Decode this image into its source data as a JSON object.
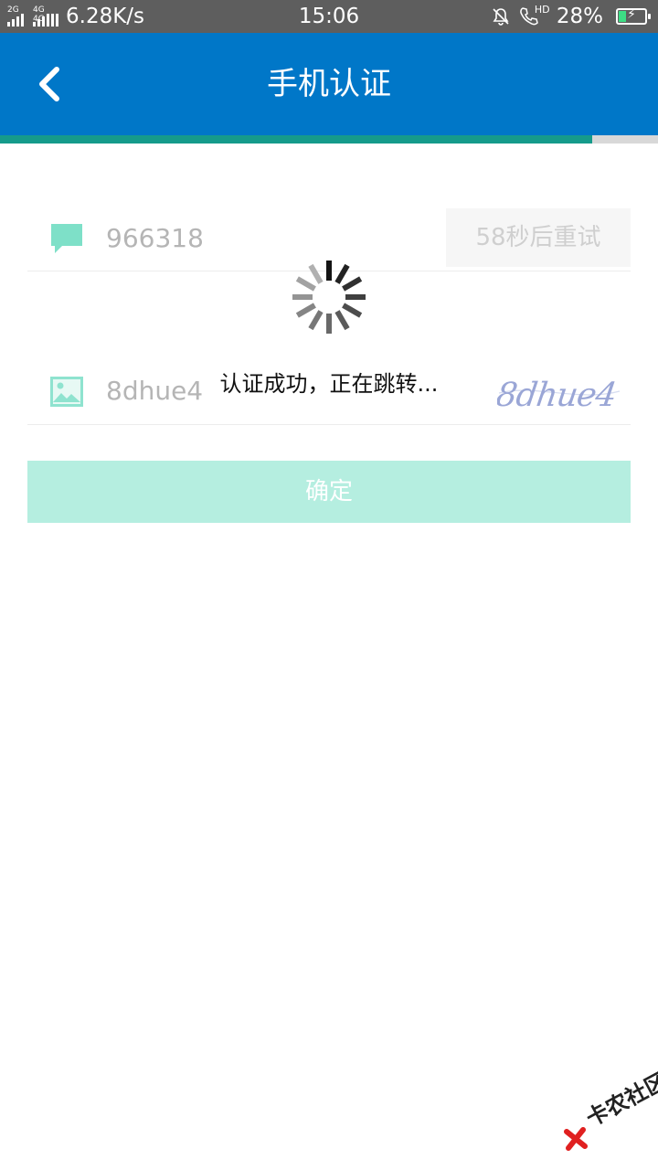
{
  "status_bar": {
    "sim1_type": "2G",
    "sim2_type": "4G 4G",
    "network_speed": "6.28K/s",
    "time": "15:06",
    "hd_label": "HD",
    "battery_percent": "28%",
    "battery_level": 0.28
  },
  "header": {
    "title": "手机认证",
    "accent_color": "#0077c8"
  },
  "progress": {
    "value": 0.9,
    "fill_color": "#159b8b"
  },
  "form": {
    "sms_code_value": "966318",
    "retry_label": "58秒后重试",
    "image_code_value": "8dhue4",
    "captcha_text": "8dhue4",
    "confirm_label": "确定"
  },
  "loading": {
    "message": "认证成功，正在跳转..."
  },
  "watermark": {
    "text": "卡农社区"
  },
  "icons": [
    "back-chevron-icon",
    "chat-bubble-icon",
    "image-icon",
    "loading-spinner-icon",
    "mute-bell-icon",
    "phone-icon",
    "battery-charging-icon"
  ]
}
